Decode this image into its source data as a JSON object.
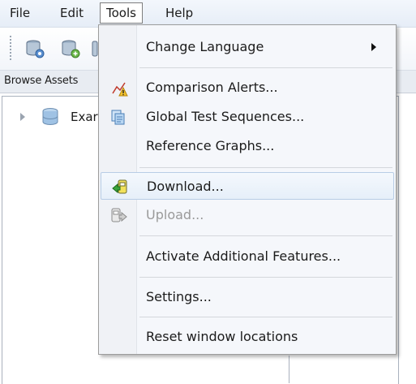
{
  "menubar": {
    "items": [
      {
        "label": "File"
      },
      {
        "label": "Edit"
      },
      {
        "label": "Tools"
      },
      {
        "label": "Help"
      }
    ]
  },
  "panel": {
    "title": "Browse Assets",
    "tree_item": {
      "label": "Exar",
      "icon": "database-icon"
    }
  },
  "tools_menu": {
    "items": [
      {
        "label": "Change Language",
        "icon": null,
        "has_submenu": true
      },
      {
        "label": "Comparison Alerts...",
        "icon": "comparison-alerts-icon"
      },
      {
        "label": "Global Test Sequences...",
        "icon": "global-test-sequences-icon"
      },
      {
        "label": "Reference Graphs...",
        "icon": null
      },
      {
        "label": "Download...",
        "icon": "download-icon",
        "highlighted": true
      },
      {
        "label": "Upload...",
        "icon": "upload-icon",
        "disabled": true
      },
      {
        "label": "Activate Additional Features...",
        "icon": null
      },
      {
        "label": "Settings...",
        "icon": null
      },
      {
        "label": "Reset window locations",
        "icon": null
      }
    ]
  },
  "toolbar": {
    "buttons": [
      "database-settings-icon",
      "database-add-icon",
      "toolbar-button-icon"
    ]
  },
  "colors": {
    "menu_background": "#f5f7fb",
    "highlight_border": "#b8cde6",
    "disabled_text": "#9a9a9a"
  }
}
